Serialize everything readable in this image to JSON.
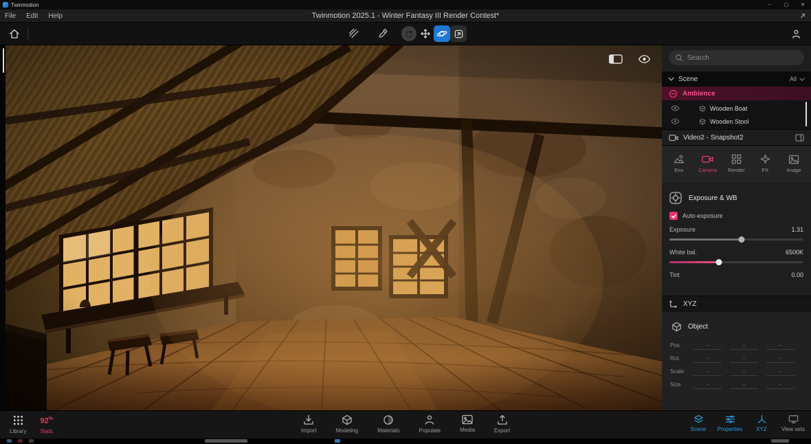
{
  "colors": {
    "pink": "#e8336d",
    "blue": "#2d9cdb"
  },
  "titlebar": {
    "app": "Twinmotion",
    "minimize": "–",
    "maximize": "▢",
    "close": "✕"
  },
  "menubar": {
    "items": [
      "File",
      "Edit",
      "Help"
    ],
    "title": "Twinmotion 2025.1 - Winter Fantasy III Render Contest*"
  },
  "right_panel": {
    "search": {
      "placeholder": "Search"
    },
    "scene_header": {
      "label": "Scene",
      "filter": "All"
    },
    "tree": {
      "selected_item": "Ambience",
      "items": [
        "Wooden Boat",
        "Wooden Stool"
      ]
    },
    "snapshot_bar": {
      "label": "Video2 - Snapshot2"
    },
    "tabs": [
      "Env",
      "Camera",
      "Render",
      "FX",
      "Image"
    ],
    "active_tab": "Camera",
    "exposure": {
      "section_title": "Exposure & WB",
      "auto_exposure_label": "Auto-exposure",
      "auto_exposure_checked": true,
      "sliders": [
        {
          "label": "Exposure",
          "value": "1.31"
        },
        {
          "label": "White bal.",
          "value": "6500K"
        },
        {
          "label": "Tint",
          "value": "0.00"
        }
      ]
    },
    "xyz_section": {
      "label": "XYZ"
    },
    "object_section": {
      "label": "Object",
      "rows": [
        "Pos.",
        "Rot.",
        "Scale",
        "Size"
      ],
      "placeholder": "-"
    }
  },
  "bottom_bar": {
    "library_label": "Library",
    "stats": {
      "value": "92",
      "unit": "%",
      "label": "Stats"
    },
    "center_items": [
      "Import",
      "Modeling",
      "Materials",
      "Populate",
      "Media",
      "Export"
    ],
    "right_items": [
      "Scene",
      "Properties",
      "XYZ",
      "View sets"
    ]
  }
}
